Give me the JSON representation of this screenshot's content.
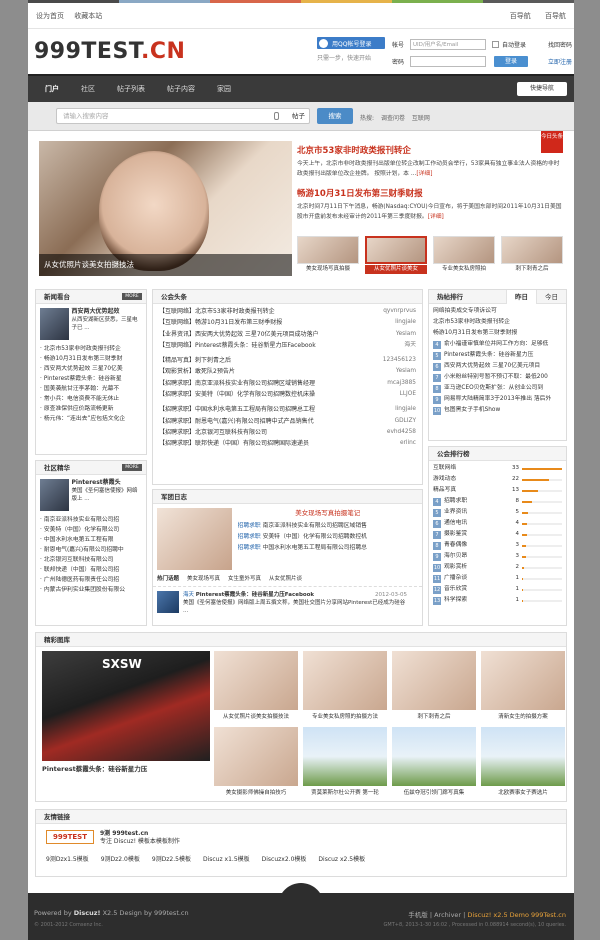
{
  "topbar": {
    "home": "设为首页",
    "fav": "收藏本站",
    "guide1": "百导航",
    "guide2": "百导航"
  },
  "logo": {
    "main": "999TEST",
    "tld": ".CN"
  },
  "header": {
    "qq_login": "用QQ帐号登录",
    "qq_sub": "只需一步，快速开始"
  },
  "login": {
    "user_label": "帐号",
    "user_placeholder": "UID/用户名/Email",
    "remember": "自动登录",
    "forgot": "找回密码",
    "pass_label": "密码",
    "login_btn": "登录",
    "register": "立即注册"
  },
  "nav": {
    "items": [
      "门户",
      "社区",
      "帖子列表",
      "帖子内容",
      "家园"
    ],
    "quick": "快捷导航"
  },
  "search": {
    "placeholder": "请输入搜索内容",
    "scope": "帖子",
    "button": "搜索",
    "hot_label": "热搜:",
    "hot": [
      "调查问卷",
      "互联网"
    ]
  },
  "feature": {
    "hero_caption": "从女优照片谈美女拍摄技法",
    "corner": "今日头条",
    "news1_title": "北京市53家非时政类报刊转企",
    "news1_text": "今天上午，北京市非时政类报刊出版单位转企改制工作动员会举行，53家具有独立事业法人资格的非时政类报刊出版单位改企挂牌。 按照计划，本 ...",
    "news2_title": "畅游10月31日发布第三财季财报",
    "news2_text": "北京时间7月11日下午消息，畅游(Nasdaq:CYOU)今日宣布，将于美国东部时间2011年10月31日美国股市开盘前发布未经审计的2011年第三季度财报。",
    "more": "[详细]",
    "thumbs": [
      "美女现场写真拍摄",
      "从女优照片谈美女",
      "专业美女私房照拍",
      "刺下刺青之后"
    ]
  },
  "newsboard": {
    "title": "新闻看台",
    "more": "MORE",
    "feat_title": "西安两大优势起效",
    "feat_text": "从西安湖新区获悉，三星电子已 ...",
    "items": [
      "北京市53家非时政类报刊转企",
      "畅游10月31日发布第三财季财",
      "西安两大优势起效 三星70亿美",
      "Pinterest蔡霞头条：硅谷新星",
      "国美袭航甘汪李茅翰：光幕不",
      "常小兵：电信资费不能无休止",
      "原查准保供应价路流畅更新",
      "杨元伟：“连出去”应包括文化企"
    ]
  },
  "community": {
    "title": "社区精华",
    "more": "MORE",
    "feat_title": "Pinterest蔡霞头",
    "feat_text": "美国《圣何塞信使报》网络版上 ...",
    "items": [
      "南京亚派科技实业有限公司招",
      "安美特（中国）化学有限公司",
      "中国水利水电第五工程有限",
      "耐恩电气(嘉兴)有限公司招聘中",
      "北京银河互联科技有限公司",
      "联邦快递（中国）有限公司招",
      "广州陆德医药有限责任公司招",
      "内蒙古伊利实业集团股份有限公"
    ]
  },
  "headlines": {
    "title": "公会头条",
    "group1": [
      {
        "t": "【互联网络】北京市53家非时政类报刊转企",
        "u": "qyvnrprvus"
      },
      {
        "t": "【互联网络】畅游10月31日发布第三财季财报",
        "u": "lingjale"
      },
      {
        "t": "【业界资讯】西安两大优势起效 三星70亿美元项目成功落户",
        "u": "Yeslam"
      },
      {
        "t": "【互联网络】Pinterest蔡霞头条：硅谷新星力压Facebook",
        "u": "海天"
      }
    ],
    "group2": [
      {
        "t": "【精品写真】刺下刺青之后",
        "u": "123456123"
      },
      {
        "t": "【观影赏析】敢死队2预告片",
        "u": "Yeslam"
      },
      {
        "t": "【招聘求职】南京亚派科技实业有限公司招聘区域销售经理",
        "u": "mcaj3885"
      },
      {
        "t": "【招聘求职】安美特（中国）化学有限公司招聘数控机床操",
        "u": "LLJOE"
      }
    ],
    "group3": [
      {
        "t": "【招聘求职】中国水利水电第五工程局有限公司招聘总工程",
        "u": "lingjale"
      },
      {
        "t": "【招聘求职】耐恩电气(嘉兴)有限公司招聘中式产品销售代",
        "u": "GDLIZY"
      },
      {
        "t": "【招聘求职】北京银河互联科技有限公司",
        "u": "evhd4258"
      },
      {
        "t": "【招聘求职】联邦快递（中国）有限公司招聘国际速递员",
        "u": "erlinc"
      }
    ]
  },
  "blog": {
    "title": "军团日志",
    "feat_title": "美女现场写真拍摄笔记",
    "lines": [
      {
        "tag": "招聘求职",
        "t": "南京亚派科技实业有限公司招聘区域销售"
      },
      {
        "tag": "招聘求职",
        "t": "安美特（中国）化学有限公司招聘数控机"
      },
      {
        "tag": "招聘求职",
        "t": "中国水利水电第五工程局有限公司招聘总"
      }
    ],
    "tags": [
      "热门话题",
      "美女现场写真",
      "女生童外写真",
      "从女优照片谈"
    ],
    "post_author": "海天",
    "post_title": "Pinterest蔡霞头条：硅谷新星力压Facebook",
    "post_date": "2012-03-05",
    "post_text": "美国《圣何塞信使报》网络版上周五撰文称，美国社交图片分享网站Pinterest已经成为硅谷 ..."
  },
  "hotrank": {
    "title": "热帖排行",
    "tabs": [
      "昨日",
      "今日"
    ],
    "items": [
      "网络拍卖成交专项诉讼可",
      "北京市53家非时政类报刊转企",
      "畅游10月31日发布第三财季财报",
      "俞小福谨审慎单位并网工作方向：足够低",
      "Pinterest蔡霞头条：硅谷新星力压",
      "西安两大优势起效 三星70亿美元项目",
      "小米粉丝特别号暂不预订不取：最低200",
      "亚马逊CEO贝佐斯扩张：从创业公司到",
      "网易称大陆精简率3于2013年推出 落后外",
      "包图黑女子手机Show"
    ]
  },
  "guildrank": {
    "title": "公会排行榜",
    "items": [
      {
        "name": "互联网络",
        "count": "33",
        "ratio": 1.0
      },
      {
        "name": "游戏动态",
        "count": "22",
        "ratio": 0.67
      },
      {
        "name": "精品写真",
        "count": "13",
        "ratio": 0.39
      },
      {
        "name": "招聘求职",
        "count": "8",
        "ratio": 0.24
      },
      {
        "name": "业界资讯",
        "count": "5",
        "ratio": 0.15
      },
      {
        "name": "通信电讯",
        "count": "4",
        "ratio": 0.12
      },
      {
        "name": "摄影鉴赏",
        "count": "4",
        "ratio": 0.12
      },
      {
        "name": "青春偶像",
        "count": "3",
        "ratio": 0.09
      },
      {
        "name": "海尔贝昂",
        "count": "3",
        "ratio": 0.09
      },
      {
        "name": "观影赏析",
        "count": "2",
        "ratio": 0.06
      },
      {
        "name": "广播杂谈",
        "count": "1",
        "ratio": 0.03
      },
      {
        "name": "音乐欣赏",
        "count": "1",
        "ratio": 0.03
      },
      {
        "name": "科学探索",
        "count": "1",
        "ratio": 0.03
      }
    ]
  },
  "gallery": {
    "title": "精彩图库",
    "big_text": "SXSW",
    "big_caption": "Pinterest蔡霞头条：硅谷新星力压",
    "cells": [
      "从女优照片谈美女拍摄技法",
      "专业美女私房照的拍摄方法",
      "刺下刺青之后",
      "清新女生的拍摄方案",
      "美女摄影师佛操自拍技巧",
      "贾莫莱斯尔杜公开赛 第一轮",
      "伍兹夺冠引领门廊写真集",
      "北欧赛事女子赛选片"
    ]
  },
  "links": {
    "title": "友情链接",
    "logo_text": "999TEST",
    "site": "9测 999test.cn",
    "desc": "专注 Discuz! 模板本模板制作",
    "items": [
      "9测Dzx1.5模板",
      "9测Dz2.0模板",
      "9测Dz2.5模板",
      "Discuz x1.5模板",
      "Discuzx2.0模板",
      "Discuz x2.5模板"
    ]
  },
  "footer": {
    "powered": "Powered by",
    "brand": "Discuz!",
    "design": "X2.5 Design by 999test.cn",
    "copyright": "© 2001-2012 Comsenz Inc.",
    "mobile": "手机版",
    "archiver": "Archiver",
    "demo": "Discuz! x2.5 Demo 999Test.cn",
    "gmt": "GMT+8, 2013-1-30 16:02 , Processed in 0.088914 second(s), 10 queries.",
    "top": "TOP"
  }
}
